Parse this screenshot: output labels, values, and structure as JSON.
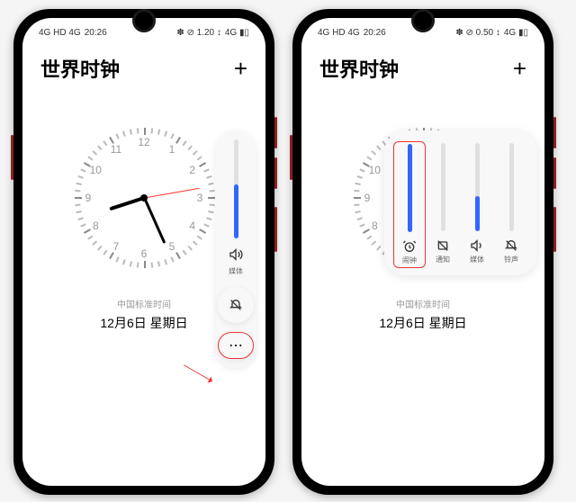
{
  "statusbar": {
    "time": "20:26",
    "left_icons": "4G HD 4G",
    "right_icons": "✽ ⊘ 1.20 ↕",
    "right_icons2": "✽ ⊘ 0.50 ↕",
    "battery": "4G ▮▯"
  },
  "header": {
    "title": "世界时钟",
    "add": "+"
  },
  "clock": {
    "timezone": "中国标准时间",
    "date": "12月6日 星期日",
    "numbers": [
      "12",
      "1",
      "2",
      "3",
      "4",
      "5",
      "6",
      "7",
      "8",
      "9",
      "10",
      "11"
    ]
  },
  "volume": {
    "media_label": "媒体",
    "media_icon": "🔊",
    "media_level": 55,
    "mute_icon": "🔕",
    "more_icon": "⋯"
  },
  "volume_wide": {
    "columns": [
      {
        "key": "alarm",
        "label": "闹钟",
        "level": 100,
        "icon": "alarm"
      },
      {
        "key": "notify",
        "label": "通知",
        "level": 0,
        "icon": "notify-off"
      },
      {
        "key": "media",
        "label": "媒体",
        "level": 40,
        "icon": "volume"
      },
      {
        "key": "ring",
        "label": "铃声",
        "level": 0,
        "icon": "ring-off"
      }
    ]
  }
}
